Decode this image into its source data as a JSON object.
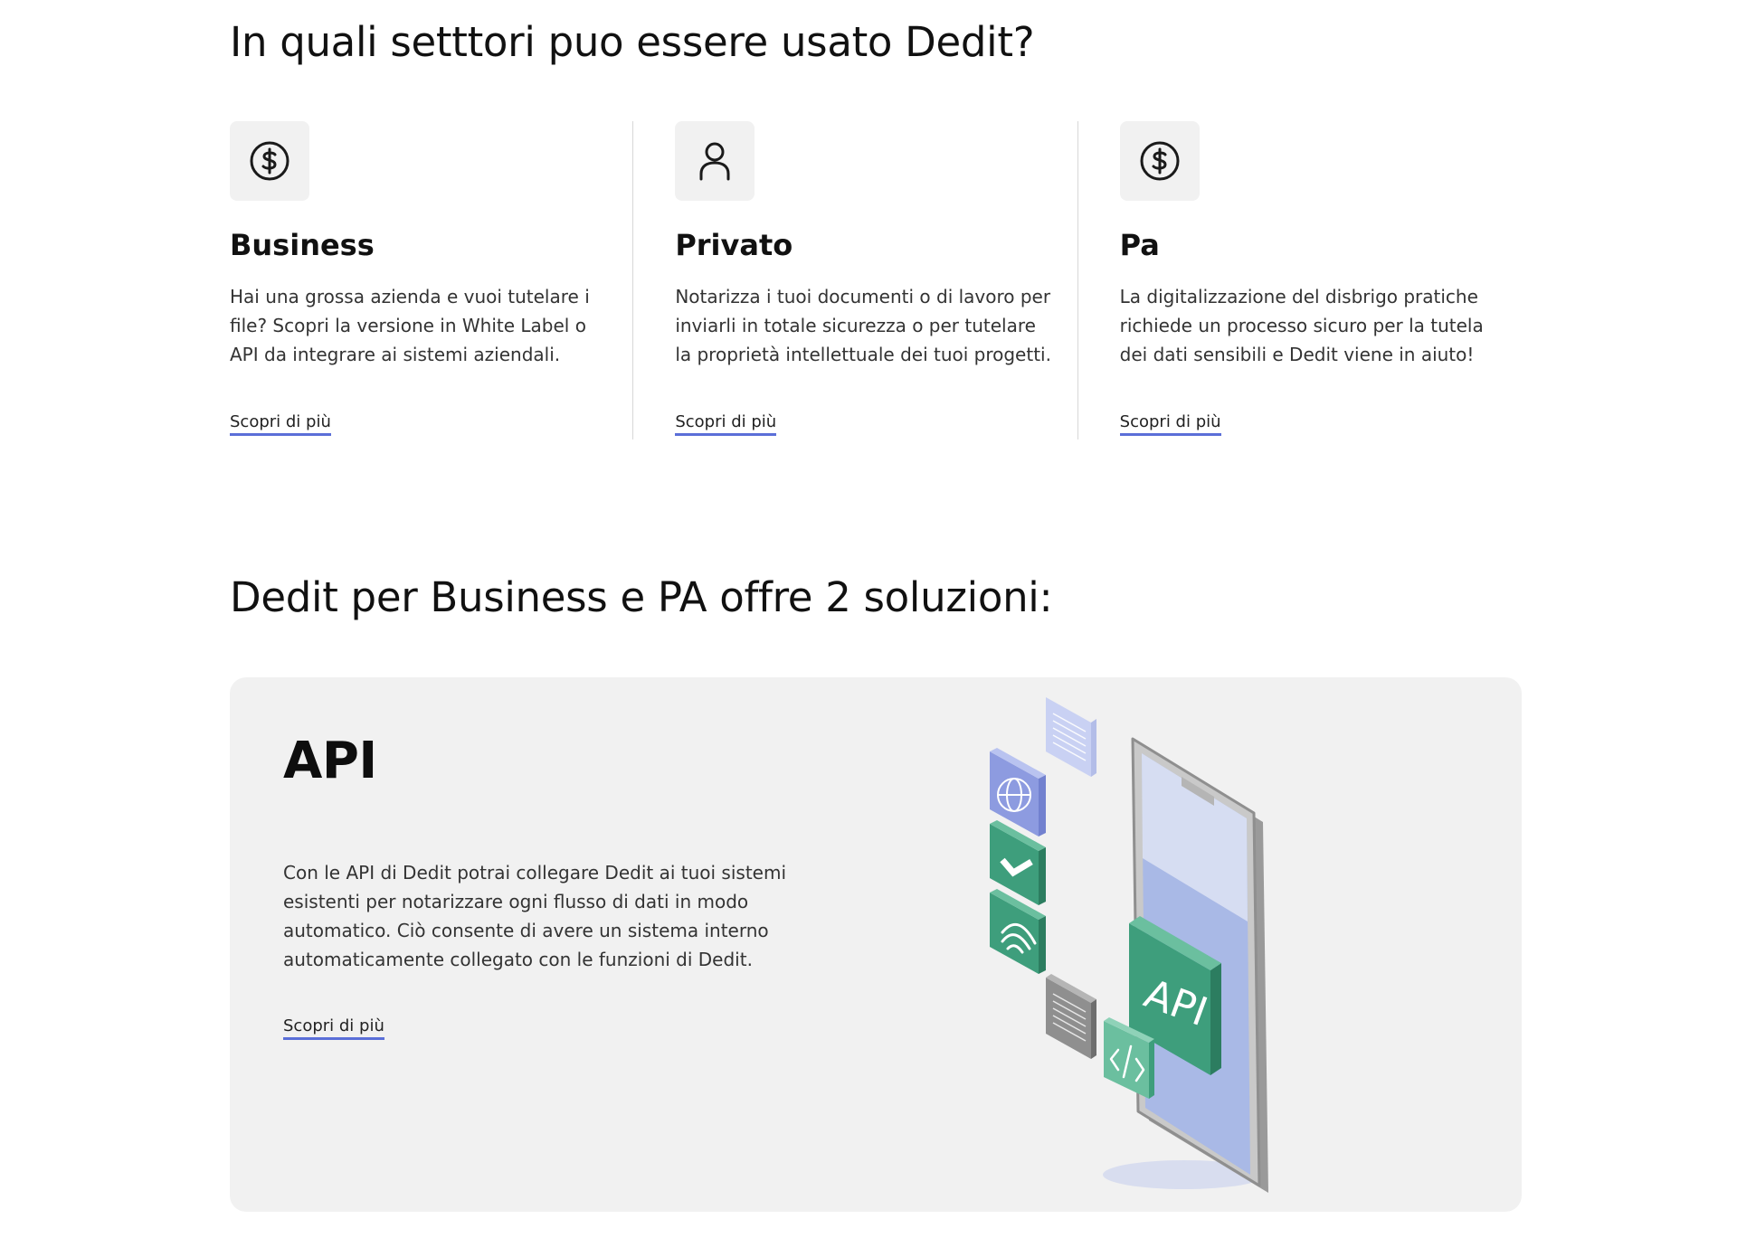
{
  "sectors_section": {
    "title": "In quali setttori puo essere usato Dedit?",
    "items": [
      {
        "icon": "dollar-circle-icon",
        "title": "Business",
        "description": "Hai una grossa azienda e vuoi tutelare i file? Scopri la versione in White Label o API da integrare ai sistemi aziendali.",
        "link": "Scopri di più"
      },
      {
        "icon": "user-icon",
        "title": "Privato",
        "description": "Notarizza i tuoi documenti o di lavoro per inviarli in totale sicurezza o per tutelare la proprietà intellettuale dei tuoi progetti.",
        "link": "Scopri di più"
      },
      {
        "icon": "dollar-circle-icon",
        "title": "Pa",
        "description": "La digitalizzazione del disbrigo pratiche richiede un processo sicuro per la tutela dei dati sensibili e Dedit viene in aiuto!",
        "link": "Scopri di più"
      }
    ]
  },
  "solutions_section": {
    "title": "Dedit per Business e PA offre 2 soluzioni:",
    "api_card": {
      "title": "API",
      "description": "Con le API di Dedit potrai collegare Dedit ai tuoi sistemi esistenti per notarizzare ogni flusso di dati in modo automatico. Ciò consente di avere un sistema interno automaticamente collegato con le funzioni di Dedit.",
      "link": "Scopri di più",
      "illustration_label": "API"
    }
  },
  "colors": {
    "link_underline": "#5b6fd8",
    "card_background": "#f1f1f1",
    "api_green": "#3e9e7c",
    "phone_screen_blue": "#a9b9e6"
  }
}
